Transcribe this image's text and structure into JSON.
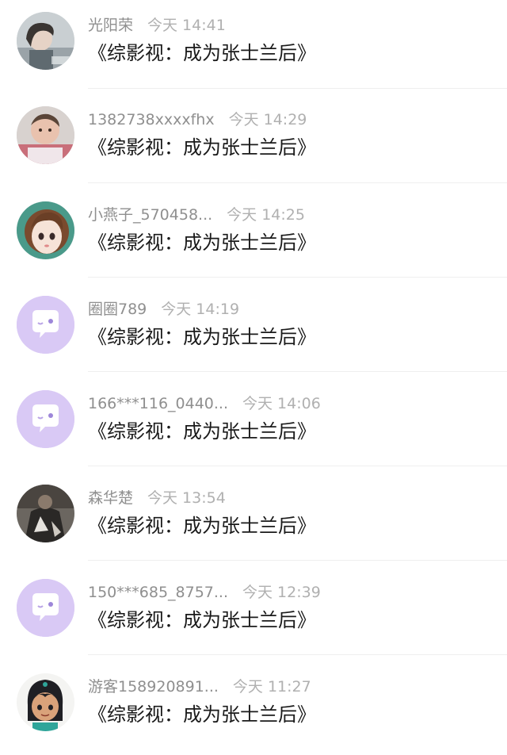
{
  "comments": [
    {
      "name": "光阳荣",
      "time": "今天 14:41",
      "text": "《综影视：成为张士兰后》",
      "avatar": "photo-woman-avatar"
    },
    {
      "name": "1382738xxxxfhx",
      "time": "今天 14:29",
      "text": "《综影视：成为张士兰后》",
      "avatar": "photo-baby-avatar"
    },
    {
      "name": "小燕子_570458...",
      "time": "今天 14:25",
      "text": "《综影视：成为张士兰后》",
      "avatar": "cartoon-girl-avatar"
    },
    {
      "name": "圈圈789",
      "time": "今天 14:19",
      "text": "《综影视：成为张士兰后》",
      "avatar": "default-chat-avatar"
    },
    {
      "name": "166***116_0440...",
      "time": "今天 14:06",
      "text": "《综影视：成为张士兰后》",
      "avatar": "default-chat-avatar"
    },
    {
      "name": "森华楚",
      "time": "今天 13:54",
      "text": "《综影视：成为张士兰后》",
      "avatar": "photo-dark-avatar"
    },
    {
      "name": "150***685_8757...",
      "time": "今天 12:39",
      "text": "《综影视：成为张士兰后》",
      "avatar": "default-chat-avatar"
    },
    {
      "name": "游客158920891...",
      "time": "今天 11:27",
      "text": "《综影视：成为张士兰后》",
      "avatar": "cartoon-princess-avatar"
    }
  ],
  "colors": {
    "default_avatar": "#d9c9f5",
    "default_avatar_icon": "#ffffff",
    "name": "#8f8f8f",
    "time": "#b0b0b0",
    "text": "#1a1a1a"
  }
}
